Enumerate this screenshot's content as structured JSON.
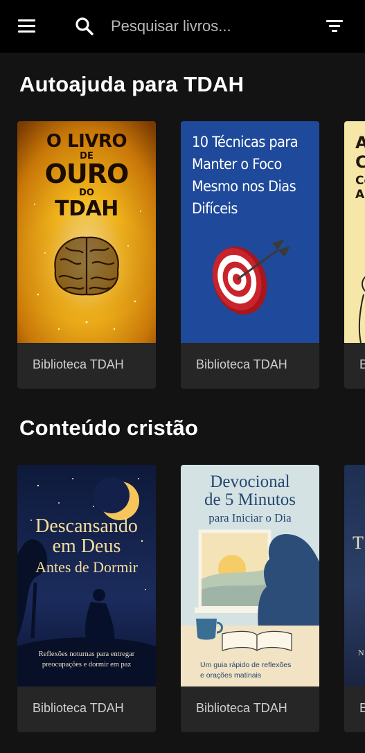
{
  "header": {
    "search_placeholder": "Pesquisar livros..."
  },
  "sections": [
    {
      "title": "Autoajuda para TDAH",
      "books": [
        {
          "cover_lines": [
            "O LIVRO",
            "DE",
            "OURO",
            "DO",
            "TDAH"
          ],
          "label": "Biblioteca TDAH"
        },
        {
          "cover_lines": [
            "10 Técnicas para",
            "Manter o Foco",
            "Mesmo nos Dias",
            "Difíceis"
          ],
          "label": "Biblioteca TDAH"
        },
        {
          "cover_lines": [
            "A",
            "C",
            "Co",
            "Au"
          ],
          "label": "B"
        }
      ]
    },
    {
      "title": "Conteúdo cristão",
      "books": [
        {
          "cover_lines": [
            "Descansando",
            "em Deus",
            "Antes de Dormir",
            "Reflexões noturnas para entregar",
            "preocupações e dormir em paz"
          ],
          "label": "Biblioteca TDAH"
        },
        {
          "cover_lines": [
            "Devocional",
            "de 5 Minutos",
            "para Iniciar o Dia",
            "Um guia rápido de reflexões",
            "e orações matinais"
          ],
          "label": "Biblioteca TDAH"
        },
        {
          "cover_lines": [
            "T",
            "N"
          ],
          "label": "B"
        }
      ]
    }
  ]
}
